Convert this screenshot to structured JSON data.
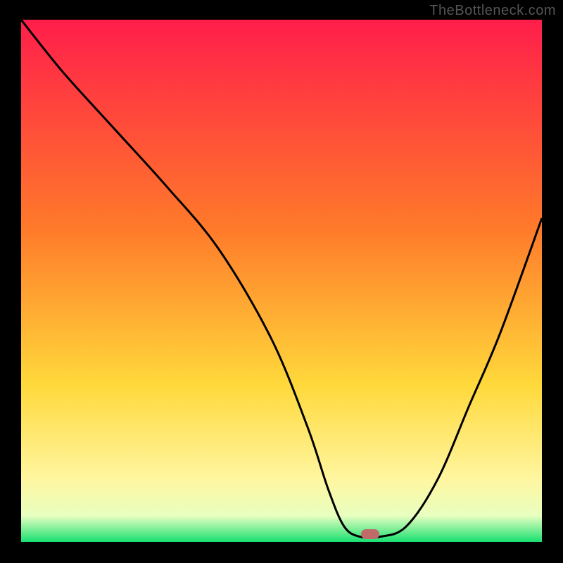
{
  "watermark": "TheBottleneck.com",
  "colors": {
    "frame": "#000000",
    "curve": "#000000",
    "marker": "#c06a6a",
    "gradient_top": "#ff1e4a",
    "gradient_mid1": "#ff7a2a",
    "gradient_mid2": "#ffd93b",
    "gradient_mid3": "#fff6a0",
    "gradient_band": "#e8ffc0",
    "gradient_bottom": "#18e070"
  },
  "chart_data": {
    "type": "line",
    "title": "",
    "xlabel": "",
    "ylabel": "",
    "xlim": [
      0,
      100
    ],
    "ylim": [
      0,
      100
    ],
    "x": [
      0,
      8,
      18,
      28,
      38,
      48,
      55,
      59,
      62,
      65,
      69,
      74,
      80,
      86,
      92,
      100
    ],
    "values": [
      100,
      90,
      79,
      68,
      56,
      39,
      22,
      10,
      3,
      1,
      1,
      3,
      12,
      26,
      40,
      62
    ],
    "marker": {
      "x": 67,
      "y": 1.5
    },
    "background_gradient_stops": [
      {
        "pct": 0,
        "meaning": "worst"
      },
      {
        "pct": 70,
        "meaning": "mid"
      },
      {
        "pct": 96,
        "meaning": "good"
      },
      {
        "pct": 100,
        "meaning": "best"
      }
    ]
  }
}
